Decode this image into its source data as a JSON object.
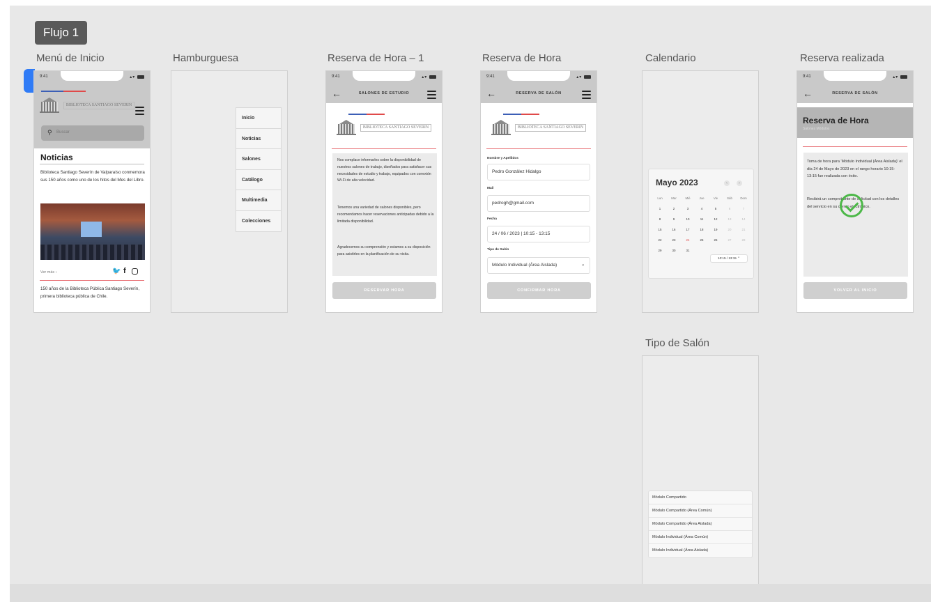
{
  "flow_label": "Flujo 1",
  "frames": {
    "menu": {
      "title": "Menú de Inicio",
      "time": "9:41",
      "logo_text": "BIBLIOTECA SANTIAGO SEVERIN",
      "search_placeholder": "Buscar",
      "news_heading": "Noticias",
      "news_text": "Biblioteca Santiago Severín de Valparaíso conmemora sus 150 años como uno de los hitos del Mes del Libro.",
      "see_more": "Ver más ›",
      "caption": "150 años de la Biblioteca Pública Santiago Severín, primera biblioteca pública de Chile."
    },
    "hamburguesa": {
      "title": "Hamburguesa",
      "menu_items": [
        "Inicio",
        "Noticias",
        "Salones",
        "Catálogo",
        "Multimedia",
        "Colecciones"
      ]
    },
    "reserva1": {
      "title": "Reserva de Hora – 1",
      "header": "SALONES DE ESTUDIO",
      "p1": "Nos complace informarles sobre la disponibilidad de nuestros salones de trabajo, diseñados para satisfacer sus necesidades de estudio y trabajo, equipados con conexión Wi-Fi de alta velocidad.",
      "p2": "Tenemos una variedad de salones disponibles, pero recomendamos hacer reservaciones anticipadas debido a la limitada disponibilidad.",
      "p3": "Agradecemos su comprensión y estamos a su disposición para asistirles en la planificación de su visita.",
      "button": "RESERVAR HORA"
    },
    "reserva": {
      "title": "Reserva de Hora",
      "header": "RESERVA DE SALÓN",
      "name_label": "Nombre y Apellidos",
      "name_value": "Pedro González Hidalgo",
      "mail_label": "Mail",
      "mail_value": "pedrogh@gmail.com",
      "date_label": "Fecha",
      "date_value": "24 / 06 / 2023  |  10:15 - 13:15",
      "type_label": "Tipo de Salón",
      "type_value": "Módulo Individual (Área Aislada)",
      "button": "CONFIRMAR HORA"
    },
    "calendario": {
      "title": "Calendario",
      "month": "Mayo 2023",
      "weekdays": [
        "Lun",
        "Mar",
        "Mié",
        "Jue",
        "Vie",
        "Sáb",
        "Dom"
      ],
      "weeks": [
        [
          "1",
          "2",
          "3",
          "4",
          "5",
          "6",
          "7"
        ],
        [
          "8",
          "9",
          "10",
          "11",
          "12",
          "13",
          "14"
        ],
        [
          "15",
          "16",
          "17",
          "18",
          "19",
          "20",
          "21"
        ],
        [
          "22",
          "23",
          "24",
          "25",
          "26",
          "27",
          "28"
        ],
        [
          "29",
          "30",
          "31",
          "",
          "",
          "",
          ""
        ]
      ],
      "selected_day": "24",
      "time_range": "10:15 / 13:15"
    },
    "realizada": {
      "title": "Reserva realizada",
      "header": "RESERVA DE SALÓN",
      "heading": "Reserva de Hora",
      "subheading": "Salones Módulos",
      "msg1": "Toma de hora para 'Módulo Individual (Área Aislada)' el día 24 de Mayo de 2023 en el rango horario 10:15- 13:15 fue realizada con éxito.",
      "msg2": "Recibirá un comprobante de solicitud con los detalles del servicio en su correo electrónico.",
      "button": "VOLVER AL INICIO"
    },
    "tipo": {
      "title": "Tipo de Salón",
      "options": [
        "Módulo Compartido",
        "Módulo Compartido (Área Común)",
        "Módulo Compartido (Área Aislada)",
        "Módulo Individual (Área Común)",
        "Módulo Individual (Área Aislada)"
      ]
    }
  }
}
